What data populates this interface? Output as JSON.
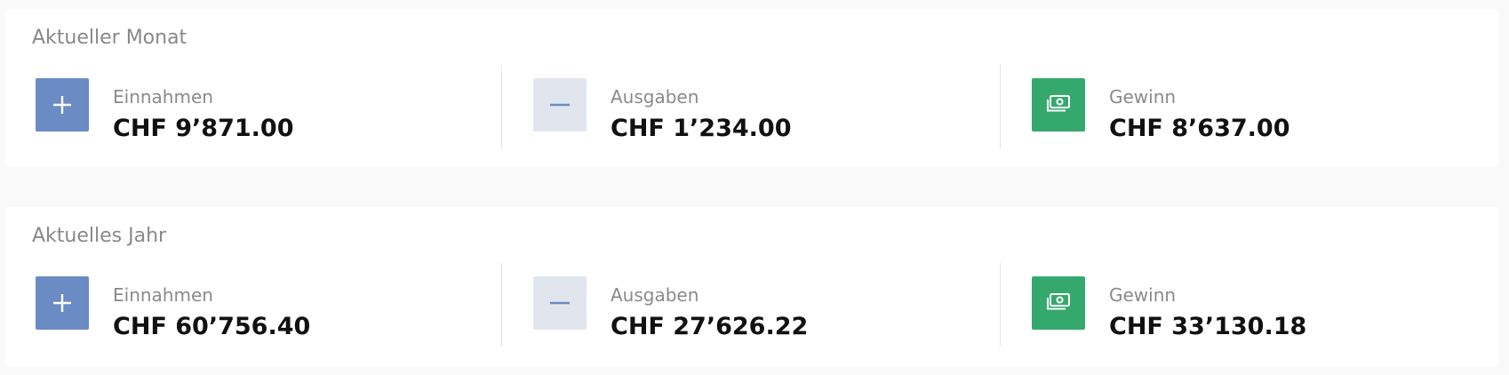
{
  "colors": {
    "income": "#6a8bc3",
    "expense": "#e1e6ee",
    "expense_icon": "#6a8bc3",
    "profit": "#35a96d"
  },
  "month": {
    "title": "Aktueller Monat",
    "income": {
      "label": "Einnahmen",
      "value": "CHF 9’871.00",
      "icon": "plus-icon"
    },
    "expense": {
      "label": "Ausgaben",
      "value": "CHF 1’234.00",
      "icon": "minus-icon"
    },
    "profit": {
      "label": "Gewinn",
      "value": "CHF 8’637.00",
      "icon": "money-icon"
    }
  },
  "year": {
    "title": "Aktuelles Jahr",
    "income": {
      "label": "Einnahmen",
      "value": "CHF 60’756.40",
      "icon": "plus-icon"
    },
    "expense": {
      "label": "Ausgaben",
      "value": "CHF 27’626.22",
      "icon": "minus-icon"
    },
    "profit": {
      "label": "Gewinn",
      "value": "CHF 33’130.18",
      "icon": "money-icon"
    }
  }
}
